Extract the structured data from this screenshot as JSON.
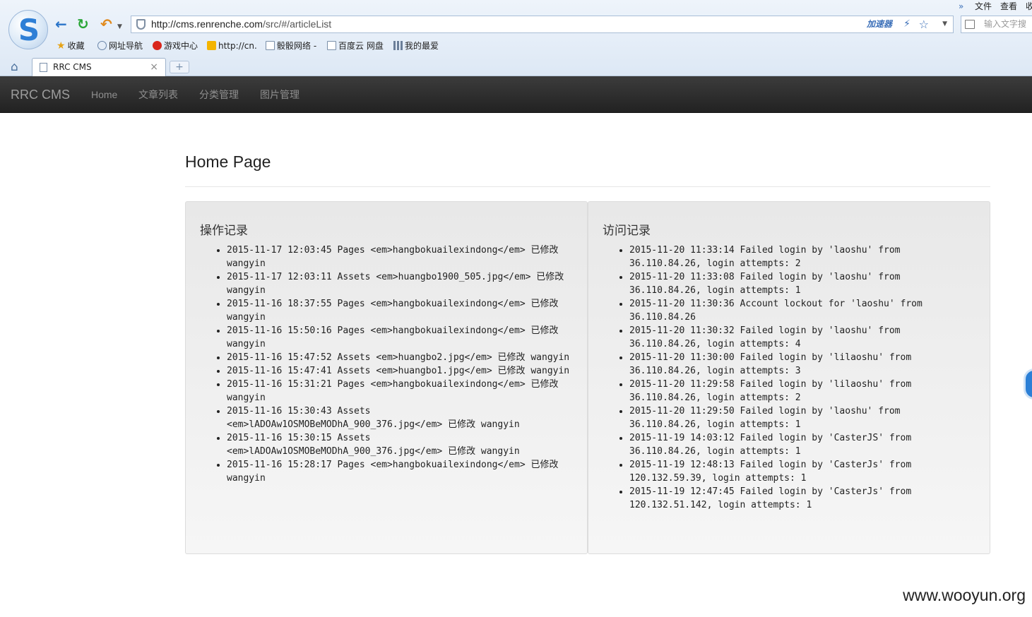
{
  "browser": {
    "url_host": "http://cms.renrenche.com",
    "url_path": "/src/#/articleList",
    "accelerator": "加速器",
    "search_placeholder": "输入文字搜",
    "menu": {
      "more": "»",
      "file": "文件",
      "view": "查看",
      "fav": "收"
    },
    "bookmarks": [
      "收藏",
      "网址导航",
      "游戏中心",
      "http://cn.",
      "骰骰网络 -",
      "百度云 网盘",
      "我的最爱"
    ],
    "tab_title": "RRC CMS",
    "new_tab": "+"
  },
  "navbar": {
    "brand": "RRC CMS",
    "items": [
      "Home",
      "文章列表",
      "分类管理",
      "图片管理"
    ]
  },
  "page": {
    "title": "Home Page"
  },
  "operation_log": {
    "title": "操作记录",
    "items": [
      "2015-11-17 12:03:45 Pages <em>hangbokuailexindong</em> 已修改 wangyin",
      "2015-11-17 12:03:11 Assets <em>huangbo1900_505.jpg</em> 已修改 wangyin",
      "2015-11-16 18:37:55 Pages <em>hangbokuailexindong</em> 已修改 wangyin",
      "2015-11-16 15:50:16 Pages <em>hangbokuailexindong</em> 已修改 wangyin",
      "2015-11-16 15:47:52 Assets <em>huangbo2.jpg</em> 已修改 wangyin",
      "2015-11-16 15:47:41 Assets <em>huangbo1.jpg</em> 已修改 wangyin",
      "2015-11-16 15:31:21 Pages <em>hangbokuailexindong</em> 已修改 wangyin",
      "2015-11-16 15:30:43 Assets <em>lADOAw1OSMOBeMODhA_900_376.jpg</em> 已修改 wangyin",
      "2015-11-16 15:30:15 Assets <em>lADOAw1OSMOBeMODhA_900_376.jpg</em> 已修改 wangyin",
      "2015-11-16 15:28:17 Pages <em>hangbokuailexindong</em> 已修改 wangyin"
    ]
  },
  "access_log": {
    "title": "访问记录",
    "items": [
      "2015-11-20 11:33:14 Failed login by 'laoshu' from 36.110.84.26, login attempts: 2",
      "2015-11-20 11:33:08 Failed login by 'laoshu' from 36.110.84.26, login attempts: 1",
      "2015-11-20 11:30:36 Account lockout for 'laoshu' from 36.110.84.26",
      "2015-11-20 11:30:32 Failed login by 'laoshu' from 36.110.84.26, login attempts: 4",
      "2015-11-20 11:30:00 Failed login by 'lilaoshu' from 36.110.84.26, login attempts: 3",
      "2015-11-20 11:29:58 Failed login by 'lilaoshu' from 36.110.84.26, login attempts: 2",
      "2015-11-20 11:29:50 Failed login by 'laoshu' from 36.110.84.26, login attempts: 1",
      "2015-11-19 14:03:12 Failed login by 'CasterJS' from 36.110.84.26, login attempts: 1",
      "2015-11-19 12:48:13 Failed login by 'CasterJs' from 120.132.59.39, login attempts: 1",
      "2015-11-19 12:47:45 Failed login by 'CasterJs' from 120.132.51.142, login attempts: 1"
    ]
  },
  "watermark": "www.wooyun.org"
}
